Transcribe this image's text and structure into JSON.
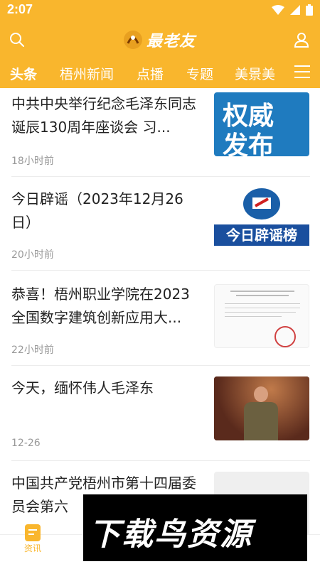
{
  "status": {
    "time": "2:07"
  },
  "header": {
    "logo_text": "最老友"
  },
  "tabs": [
    {
      "label": "头条"
    },
    {
      "label": "梧州新闻"
    },
    {
      "label": "点播"
    },
    {
      "label": "专题"
    },
    {
      "label": "美景美"
    }
  ],
  "feed": [
    {
      "title": "中共中央举行纪念毛泽东同志诞辰130周年座谈会 习...",
      "time": "18小时前",
      "thumb_text_1": "权威",
      "thumb_text_2": "发布"
    },
    {
      "title": "今日辟谣（2023年12月26日）",
      "time": "20小时前",
      "thumb_text_1": "今日辟谣榜"
    },
    {
      "title": "恭喜！梧州职业学院在2023全国数字建筑创新应用大...",
      "time": "22小时前"
    },
    {
      "title": "今天，缅怀伟人毛泽东",
      "time": "12-26"
    },
    {
      "title": "中国共产党梧州市第十四届委员会第六",
      "time": ""
    }
  ],
  "bottom_nav": {
    "news_label": "资讯"
  },
  "watermark": {
    "text": "下载鸟资源"
  },
  "colors": {
    "accent": "#F9B62D"
  }
}
